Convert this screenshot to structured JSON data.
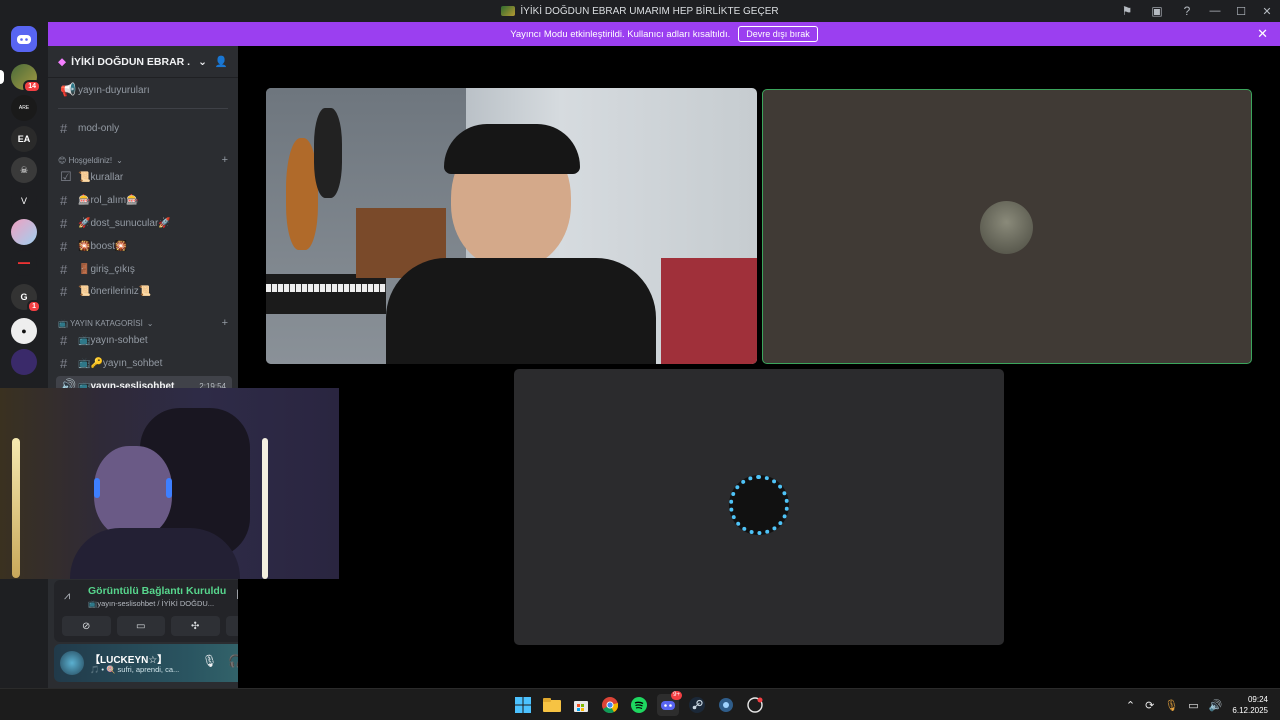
{
  "window": {
    "title": "İYİKİ DOĞDUN EBRAR UMARIM HEP BİRLİKTE GEÇER",
    "controls": [
      "minimize",
      "maximize",
      "close"
    ]
  },
  "banner": {
    "message": "Yayıncı Modu etkinleştirildi. Kullanıcı adları kısaltıldı.",
    "button": "Devre dışı bırak"
  },
  "server_rail": {
    "badges": [
      "14",
      "1"
    ]
  },
  "server": {
    "name": "İYİKİ DOĞDUN EBRAR ..."
  },
  "channels": {
    "top": [
      {
        "name": "yayın-duyuruları",
        "icon": "megaphone-icon"
      },
      {
        "name": "mod-only",
        "icon": "hash-icon"
      }
    ],
    "categories": [
      {
        "name": "😊 Hoşgeldiniz!",
        "channels": [
          {
            "name": "📜kurallar",
            "icon": "rules-icon"
          },
          {
            "name": "🎰rol_alım🎰",
            "icon": "hash-icon"
          },
          {
            "name": "🚀dost_sunucular🚀",
            "icon": "hash-icon"
          },
          {
            "name": "🎇boost🎇",
            "icon": "hash-icon"
          },
          {
            "name": "🚪giriş_çıkış",
            "icon": "hash-icon"
          },
          {
            "name": "📜önerileriniz📜",
            "icon": "hash-icon"
          }
        ]
      },
      {
        "name": "📺 YAYIN KATAGORİSİ",
        "channels": [
          {
            "name": "📺yayın-sohbet",
            "icon": "hash-icon"
          },
          {
            "name": "📺🔑yayın_sohbet",
            "icon": "hash-icon"
          },
          {
            "name": "📺yayın-seslisohbet",
            "icon": "voice-icon",
            "time": "2:19:54",
            "active": true
          }
        ]
      }
    ]
  },
  "voice": {
    "status": "Görüntülü Bağlantı Kuruldu",
    "channel": "📺yayın-seslisohbet / İYİKİ DOĞDU..."
  },
  "user": {
    "name": "【LUCKEYN☆】",
    "status": "🎵 • 🍭 sufri, aprendi, ca..."
  },
  "taskbar": {
    "time": "09:24",
    "date": "6.12.2025",
    "apps": [
      "windows-start-icon",
      "file-explorer-icon",
      "store-icon",
      "chrome-icon",
      "spotify-icon",
      "discord-icon",
      "steam-icon",
      "app-icon",
      "app-icon"
    ],
    "discord_badge": "9+"
  },
  "colors": {
    "banner": "#9b3ff0",
    "speaking_border": "#3ba55c",
    "connected_text": "#57d68d"
  }
}
